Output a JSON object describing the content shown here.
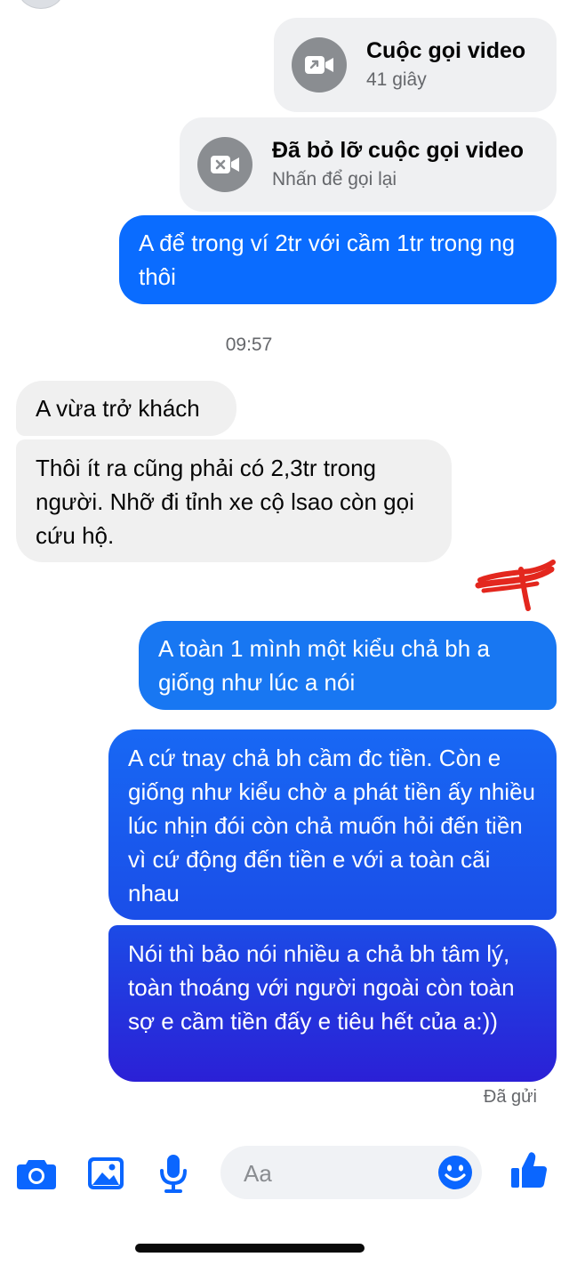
{
  "colors": {
    "accent": "#0a66ff",
    "bubble_gradient_top": "#1877f2",
    "bubble_gradient_bottom": "#2a1fd6",
    "incoming_bubble": "#f0f0f0",
    "call_bubble": "#eff0f2",
    "scribble": "#e3271e"
  },
  "calls": [
    {
      "title": "Cuộc gọi video",
      "subtitle": "41 giây",
      "icon": "video-call-icon"
    },
    {
      "title": "Đã bỏ lỡ cuộc gọi video",
      "subtitle": "Nhấn để gọi lại",
      "icon": "missed-video-call-icon"
    }
  ],
  "messages": {
    "out_1": "A để trong ví 2tr với cầm 1tr trong ng thôi",
    "timestamp": "09:57",
    "in_1": "A vừa trở khách",
    "in_2": "Thôi ít ra cũng phải có 2,3tr trong người. Nhỡ đi tỉnh xe cộ lsao còn gọi cứu hộ.",
    "out_2": "A toàn 1 mình một kiểu chả bh a giống như lúc a nói",
    "out_3": "A cứ tnay chả bh cầm đc tiền. Còn e giống như kiểu chờ a phát tiền ấy nhiều lúc nhịn đói còn chả muốn hỏi đến tiền vì cứ động đến tiền e với a toàn cãi nhau",
    "out_4": "Nói thì bảo nói nhiều a chả bh tâm lý, toàn thoáng với người ngoài còn toàn sợ e cầm tiền đấy e tiêu hết của a:))"
  },
  "status": "Đã gửi",
  "composer": {
    "placeholder": "Aa",
    "icons": [
      "camera-icon",
      "image-icon",
      "microphone-icon",
      "emoji-icon",
      "thumbs-up-icon"
    ]
  }
}
